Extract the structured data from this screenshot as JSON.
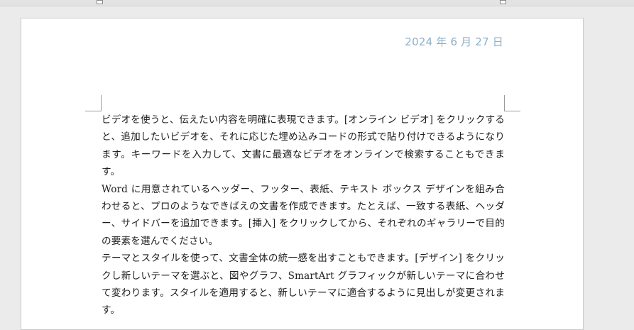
{
  "document": {
    "date": "2024 年 6 月 27 日",
    "paragraphs": [
      "ビデオを使うと、伝えたい内容を明確に表現できます。[オンライン ビデオ] をクリックすると、追加したいビデオを、それに応じた埋め込みコードの形式で貼り付けできるようになります。キーワードを入力して、文書に最適なビデオをオンラインで検索することもできます。",
      "Word に用意されているヘッダー、フッター、表紙、テキスト ボックス デザインを組み合わせると、プロのようなできばえの文書を作成できます。たとえば、一致する表紙、ヘッダー、サイドバーを追加できます。[挿入] をクリックしてから、それぞれのギャラリーで目的の要素を選んでください。",
      "テーマとスタイルを使って、文書全体の統一感を出すこともできます。[デザイン] をクリックし新しいテーマを選ぶと、図やグラフ、SmartArt グラフィックが新しいテーマに合わせて変わります。スタイルを適用すると、新しいテーマに適合するように見出しが変更されます。"
    ]
  }
}
